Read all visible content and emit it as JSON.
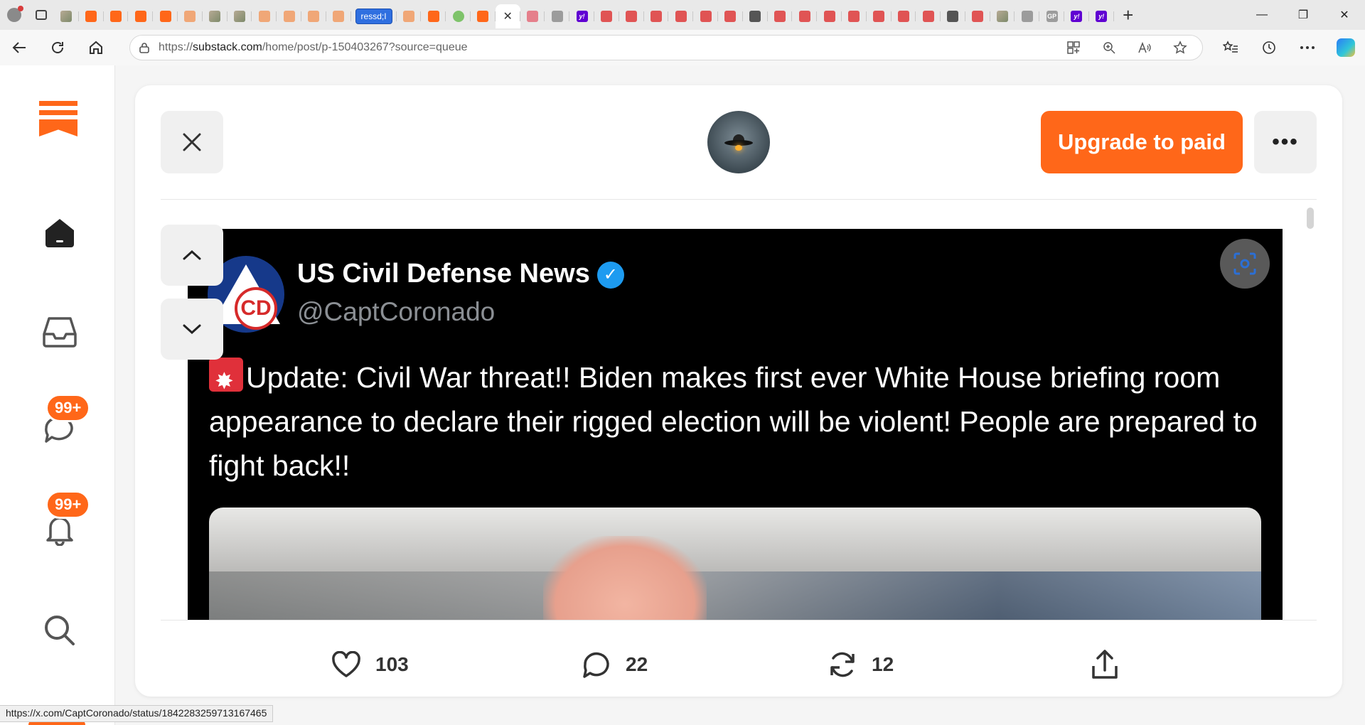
{
  "browser": {
    "tabs": [
      {
        "type": "image"
      },
      {
        "type": "substack"
      },
      {
        "type": "substack"
      },
      {
        "type": "substack"
      },
      {
        "type": "substack"
      },
      {
        "type": "substack-faded"
      },
      {
        "type": "image"
      },
      {
        "type": "image"
      },
      {
        "type": "substack-faded"
      },
      {
        "type": "substack-faded"
      },
      {
        "type": "substack-faded"
      },
      {
        "type": "substack-faded"
      }
    ],
    "labeled_tab": "ressd;I",
    "tabs_after": [
      {
        "type": "substack-faded"
      },
      {
        "type": "substack"
      },
      {
        "type": "play"
      },
      {
        "type": "substack"
      }
    ],
    "active_tab_close": "✕",
    "tabs_right": [
      {
        "type": "pink"
      },
      {
        "type": "grey"
      },
      {
        "type": "yahoo",
        "glyph": "y!"
      },
      {
        "type": "youtube"
      },
      {
        "type": "youtube"
      },
      {
        "type": "youtube"
      },
      {
        "type": "youtube"
      },
      {
        "type": "youtube"
      },
      {
        "type": "youtube"
      },
      {
        "type": "dark"
      },
      {
        "type": "youtube"
      },
      {
        "type": "youtube"
      },
      {
        "type": "youtube"
      },
      {
        "type": "youtube"
      },
      {
        "type": "youtube"
      },
      {
        "type": "youtube"
      },
      {
        "type": "youtube"
      },
      {
        "type": "dark"
      },
      {
        "type": "youtube"
      },
      {
        "type": "image"
      },
      {
        "type": "grey"
      },
      {
        "type": "grey",
        "glyph": "GP"
      },
      {
        "type": "yahoo",
        "glyph": "y!"
      },
      {
        "type": "yahoo",
        "glyph": "y!"
      }
    ],
    "new_tab": "+",
    "window_controls": {
      "minimize": "—",
      "restore": "❐",
      "close": "✕"
    },
    "url_prefix": "https://",
    "url_host": "substack.com",
    "url_path": "/home/post/p-150403267?source=queue",
    "status_link": "https://x.com/CaptCoronado/status/1842283259713167465"
  },
  "sidebar": {
    "chat_badge": "99+",
    "notifications_badge": "99+"
  },
  "post": {
    "upgrade_label": "Upgrade to paid",
    "more_label": "•••",
    "tweet": {
      "name": "US Civil Defense News",
      "handle": "@CaptCoronado",
      "logo_text": "CD",
      "text": "Update: Civil War threat!! Biden makes first ever White House briefing room appearance to declare their rigged election will be violent! People are prepared to fight back!!"
    },
    "actions": {
      "likes": "103",
      "comments": "22",
      "restacks": "12"
    }
  },
  "colors": {
    "brand": "#ff6719",
    "verified": "#1d9bf0",
    "tweet_bg": "#000000"
  }
}
